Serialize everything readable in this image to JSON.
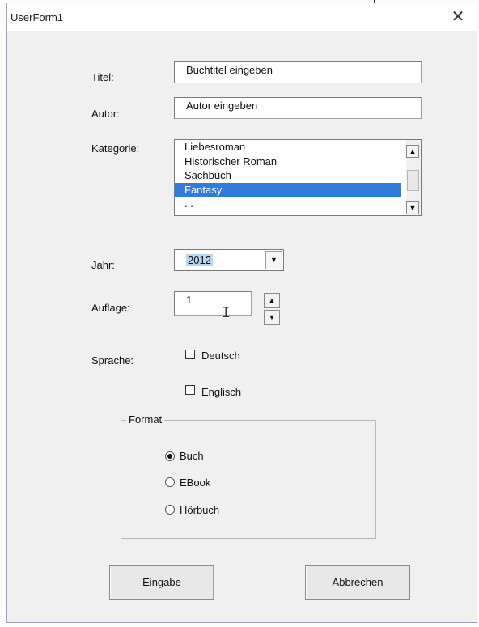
{
  "window": {
    "title": "UserForm1",
    "close_glyph": "✕"
  },
  "labels": {
    "titel": "Titel:",
    "autor": "Autor:",
    "kategorie": "Kategorie:",
    "jahr": "Jahr:",
    "auflage": "Auflage:",
    "sprache": "Sprache:"
  },
  "fields": {
    "titel_value": "Buchtitel eingeben",
    "autor_value": "Autor eingeben",
    "jahr_value": "2012",
    "auflage_value": "1"
  },
  "kategorie": {
    "items": [
      "Liebesroman",
      "Historischer Roman",
      "Sachbuch",
      "Fantasy",
      "..."
    ],
    "selected_index": 3
  },
  "sprache": {
    "deutsch": {
      "label": "Deutsch",
      "checked": false
    },
    "englisch": {
      "label": "Englisch",
      "checked": false
    }
  },
  "format": {
    "caption": "Format",
    "options": [
      {
        "label": "Buch",
        "selected": true
      },
      {
        "label": "EBook",
        "selected": false
      },
      {
        "label": "Hörbuch",
        "selected": false
      }
    ]
  },
  "buttons": {
    "eingabe": "Eingabe",
    "abbrechen": "Abbrechen"
  },
  "icons": {
    "scroll_up": "▲",
    "scroll_down": "▼",
    "dropdown": "▼",
    "spin_up": "▲",
    "spin_down": "▼",
    "text_cursor": "I"
  },
  "colors": {
    "selection": "#2f7cdc",
    "combo_highlight": "#b9d6f5"
  }
}
